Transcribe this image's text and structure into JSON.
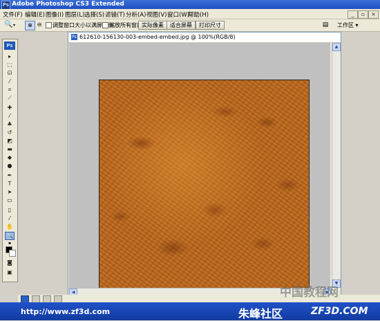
{
  "window": {
    "title": "Adobe Photoshop CS3 Extended",
    "app_icon": "Ps"
  },
  "menu": [
    "文件(F)",
    "编辑(E)",
    "图像(I)",
    "图层(L)",
    "选择(S)",
    "滤镜(T)",
    "分析(A)",
    "视图(V)",
    "窗口(W)",
    "帮助(H)"
  ],
  "options_bar": {
    "tool_icon": "zoom-icon",
    "checkbox1_label": "调整窗口大小以满屏显示",
    "checkbox2_label": "缩放所有窗口",
    "btn_actual_pixels": "实际像素",
    "btn_fit_screen": "适合屏幕",
    "btn_print_size": "打印尺寸",
    "workspace_label": "工作区 ▾"
  },
  "tools_panel": {
    "logo": "Ps"
  },
  "document": {
    "title": "612610-156130-003-embed-embed.jpg @ 100%(RGB/8)"
  },
  "footer": {
    "url": "http://www.zf3d.com",
    "brand_cn": "朱峰社区",
    "brand_site": "ZF3D.COM",
    "watermark": "中国教程网"
  },
  "colors": {
    "title_bar": "#2457cb",
    "leather_base": "#b86e24",
    "canvas_bg": "#c0c0c0",
    "banner": "#1a48b8"
  }
}
